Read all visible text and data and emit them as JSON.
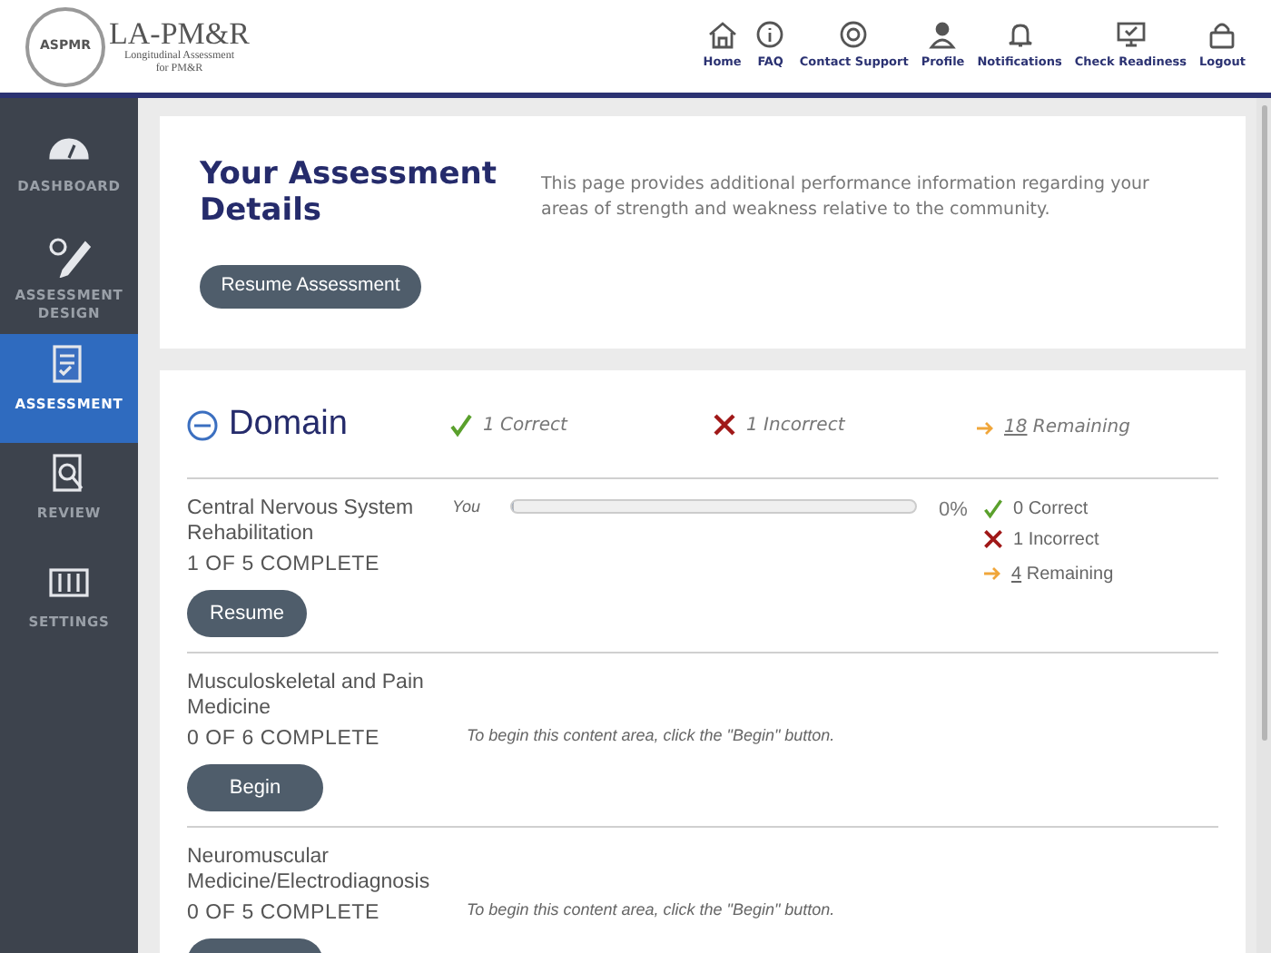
{
  "logo": {
    "seal_text": "ASPMR",
    "title": "LA-PM&R",
    "subtitle_1": "Longitudinal Assessment",
    "subtitle_2": "for PM&R"
  },
  "top_nav": [
    {
      "label": "Home",
      "kind": "home"
    },
    {
      "label": "FAQ",
      "kind": "faq"
    },
    {
      "label": "Contact Support",
      "kind": "support"
    },
    {
      "label": "Profile",
      "kind": "profile"
    },
    {
      "label": "Notifications",
      "kind": "notifications"
    },
    {
      "label": "Check Readiness",
      "kind": "readiness"
    },
    {
      "label": "Logout",
      "kind": "logout"
    }
  ],
  "sidebar": {
    "items": [
      {
        "label": "DASHBOARD",
        "kind": "dashboard",
        "selected": false
      },
      {
        "label": "ASSESSMENT DESIGN",
        "kind": "design",
        "selected": false
      },
      {
        "label": "ASSESSMENT",
        "kind": "assessment",
        "selected": true
      },
      {
        "label": "REVIEW",
        "kind": "review",
        "selected": false
      },
      {
        "label": "SETTINGS",
        "kind": "settings",
        "selected": false
      }
    ]
  },
  "details": {
    "title": "Your Assessment Details",
    "description": "This page provides additional performance information regarding your areas of strength and weakness relative to the community.",
    "button": "Resume Assessment"
  },
  "domain": {
    "title": "Domain",
    "expanded": true,
    "correct": "1 Correct",
    "incorrect": "1 Incorrect",
    "remaining_count": "18",
    "remaining_label": "Remaining",
    "rows": [
      {
        "kind": "progress",
        "name": "Central Nervous System Rehabilitation",
        "complete": "1 OF 5 COMPLETE",
        "button": "Resume",
        "you_label": "You",
        "level": 0,
        "percent": "0%",
        "correct": "0 Correct",
        "incorrect": "1 Incorrect",
        "remaining_count": "4",
        "remaining_label": "Remaining"
      },
      {
        "kind": "not_started",
        "name": "Musculoskeletal and Pain Medicine",
        "complete": "0 OF 6 COMPLETE",
        "button": "Begin",
        "hint": "To begin this content area, click the \"Begin\" button."
      },
      {
        "kind": "not_started",
        "name": "Neuromuscular Medicine/Electrodiagnosis",
        "complete": "0 OF 5 COMPLETE",
        "hint": "To begin this content area, click the \"Begin\" button."
      }
    ]
  }
}
